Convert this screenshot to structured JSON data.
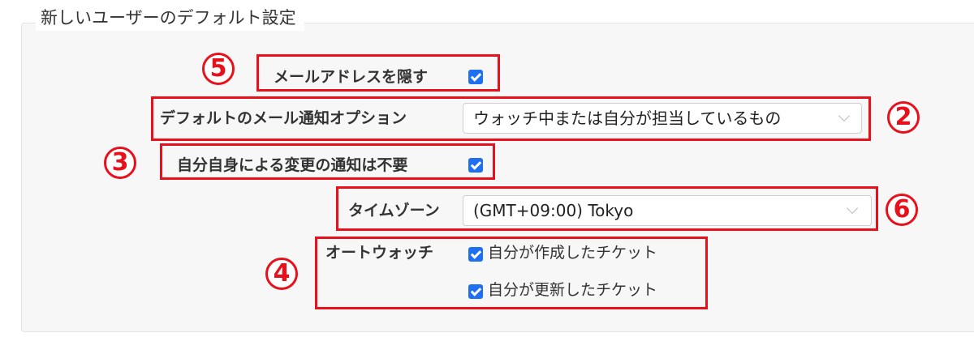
{
  "section": {
    "title": "新しいユーザーのデフォルト設定"
  },
  "settings": {
    "hide_email": {
      "label": "メールアドレスを隠す",
      "checked": true
    },
    "mail_notification": {
      "label": "デフォルトのメール通知オプション",
      "value": "ウォッチ中または自分が担当しているもの"
    },
    "no_self_notified": {
      "label": "自分自身による変更の通知は不要",
      "checked": true
    },
    "time_zone": {
      "label": "タイムゾーン",
      "value": "(GMT+09:00) Tokyo"
    },
    "auto_watch": {
      "label": "オートウォッチ",
      "options": [
        {
          "label": "自分が作成したチケット",
          "checked": true
        },
        {
          "label": "自分が更新したチケット",
          "checked": true
        }
      ]
    }
  },
  "annotations": {
    "marker_5": "5",
    "marker_2": "2",
    "marker_3": "3",
    "marker_6": "6",
    "marker_4": "4",
    "highlight_color": "#e8101a"
  },
  "colors": {
    "checkbox_accent": "#1f6ff2",
    "panel_background": "#f7f7f8"
  }
}
